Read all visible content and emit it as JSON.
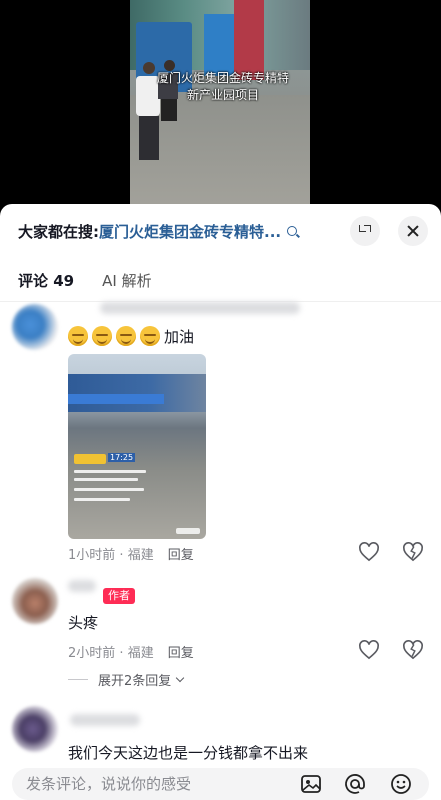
{
  "video": {
    "caption_line1": "厦门火炬集团金砖专精特",
    "caption_line2": "新产业园项目"
  },
  "sheet": {
    "search_prefix": "大家都在搜:",
    "search_query": "厦门火炬集团金砖专精特...",
    "tabs": [
      {
        "label": "评论 49"
      },
      {
        "label": "AI 解析"
      }
    ]
  },
  "comments": [
    {
      "text": "加油",
      "emoji_count": 4,
      "time": "1小时前",
      "location": "福建",
      "reply_label": "回复"
    },
    {
      "badge": "作者",
      "text": "头疼",
      "time": "2小时前",
      "location": "福建",
      "reply_label": "回复",
      "expand_label": "展开2条回复"
    },
    {
      "text": "我们今天这边也是一分钱都拿不出来"
    }
  ],
  "comment_image": {
    "stamp_time": "17:25"
  },
  "input": {
    "placeholder": "发条评论，说说你的感受"
  },
  "colors": {
    "accent": "#fe2c55",
    "link": "#2b5f96"
  }
}
